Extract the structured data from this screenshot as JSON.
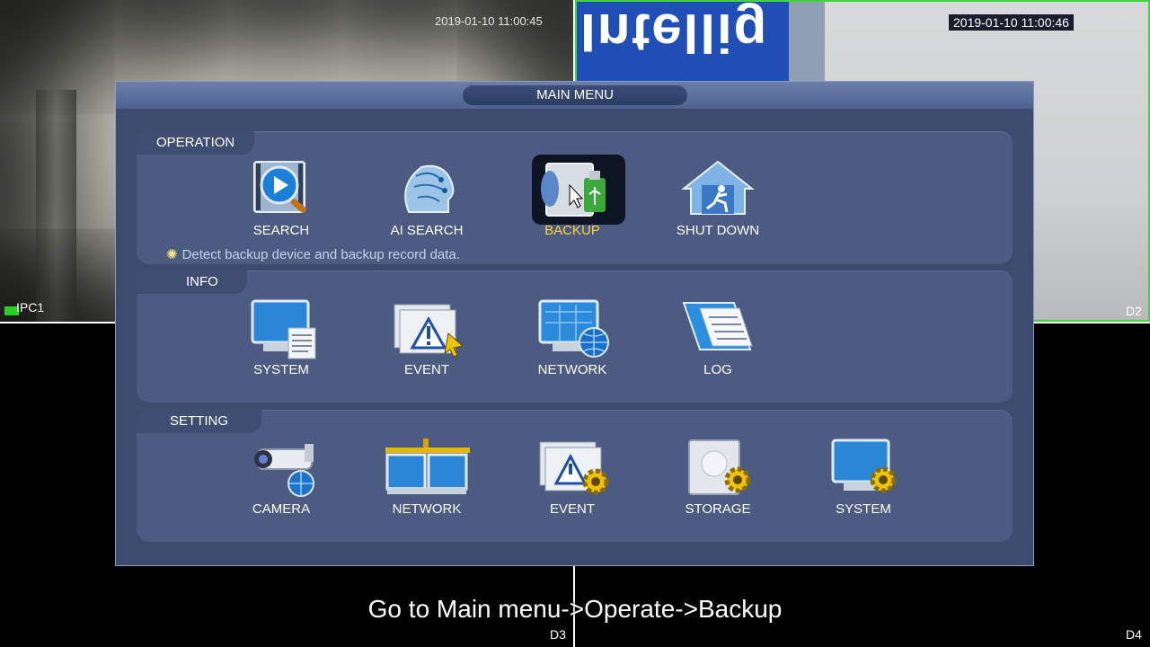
{
  "cameras": {
    "cam1": {
      "timestamp": "2019-01-10 11:00:45",
      "label": "IPC1"
    },
    "cam2": {
      "timestamp": "2019-01-10 11:00:46",
      "timestamp_small": "00:46",
      "label": "D2",
      "sign_text": "Intellig"
    },
    "cam3": {
      "label": "D3"
    },
    "cam4": {
      "label": "D4"
    }
  },
  "menu": {
    "title": "MAIN MENU",
    "operation": {
      "header": "OPERATION",
      "items": [
        "SEARCH",
        "AI SEARCH",
        "BACKUP",
        "SHUT DOWN"
      ],
      "selected": "BACKUP",
      "hint": "Detect backup device and backup record data."
    },
    "info": {
      "header": "INFO",
      "items": [
        "SYSTEM",
        "EVENT",
        "NETWORK",
        "LOG"
      ]
    },
    "setting": {
      "header": "SETTING",
      "items": [
        "CAMERA",
        "NETWORK",
        "EVENT",
        "STORAGE",
        "SYSTEM"
      ]
    }
  },
  "caption": "Go to Main menu->Operate->Backup",
  "colors": {
    "menu_bg": "#3c4b6e",
    "section_bg": "#4b5b82",
    "selected_label": "#ffd338",
    "active_border": "#3ed63a"
  }
}
